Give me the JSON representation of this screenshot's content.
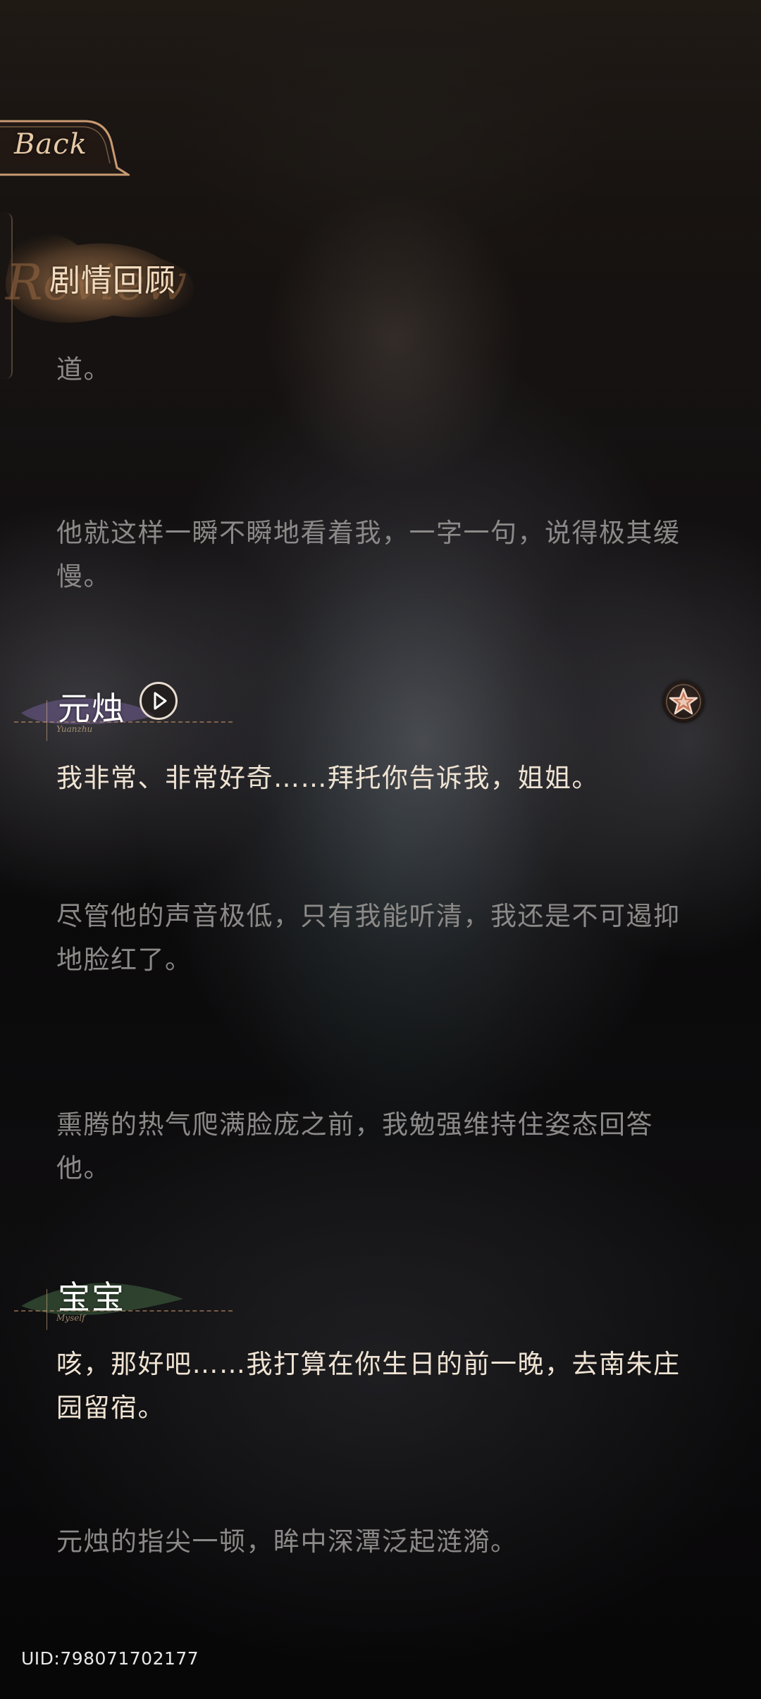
{
  "header": {
    "back_label": "Back",
    "title": "剧情回顾",
    "title_deco": "Review"
  },
  "story": [
    {
      "type": "narration",
      "text": "道。"
    },
    {
      "type": "narration",
      "text": "他就这样一瞬不瞬地看着我，一字一句，说得极其缓慢。"
    },
    {
      "type": "speaker",
      "name": "元烛",
      "subname": "Yuanzhu"
    },
    {
      "type": "dialogue",
      "text": "我非常、非常好奇……拜托你告诉我，姐姐。"
    },
    {
      "type": "narration",
      "text": "尽管他的声音极低，只有我能听清，我还是不可遏抑地脸红了。"
    },
    {
      "type": "narration",
      "text": "熏腾的热气爬满脸庞之前，我勉强维持住姿态回答他。"
    },
    {
      "type": "speaker",
      "name": "宝宝",
      "subname": "Myself"
    },
    {
      "type": "dialogue",
      "text": "咳，那好吧……我打算在你生日的前一晚，去南朱庄园留宿。"
    },
    {
      "type": "narration",
      "text": "元烛的指尖一顿，眸中深潭泛起涟漪。"
    }
  ],
  "footer": {
    "uid": "UID:798071702177"
  },
  "colors": {
    "narration": "#8c8a88",
    "dialogue": "#efe3d3",
    "accent_gold": "#e6c9a6",
    "speaker_brush_purple": "#6a5a8a",
    "speaker_brush_green": "#3c5a3c",
    "favorite_star": "#c8785a"
  },
  "icons": {
    "play": "play-voice-icon",
    "favorite": "star-icon"
  }
}
